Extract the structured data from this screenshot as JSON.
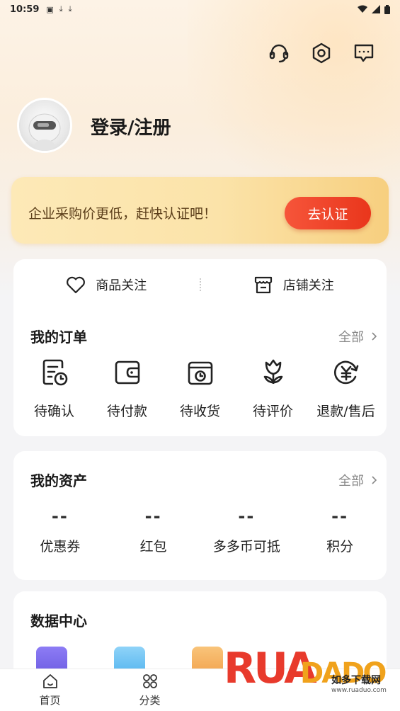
{
  "status_bar": {
    "time": "10:59",
    "icons": [
      "notification-a-icon",
      "download-icon",
      "download-icon"
    ],
    "right_icons": [
      "wifi-icon",
      "signal-icon",
      "battery-icon"
    ]
  },
  "header": {
    "icons": [
      "customer-service-icon",
      "settings-icon",
      "message-icon"
    ],
    "login_text": "登录/注册"
  },
  "banner": {
    "text": "企业采购价更低，赶快认证吧！",
    "button": "去认证",
    "accent": "#ee4328"
  },
  "follow": {
    "items": [
      {
        "label": "商品关注",
        "icon": "heart-icon"
      },
      {
        "label": "店铺关注",
        "icon": "store-icon"
      }
    ]
  },
  "orders": {
    "title": "我的订单",
    "more": "全部",
    "items": [
      {
        "label": "待确认",
        "icon": "pending-confirm-icon"
      },
      {
        "label": "待付款",
        "icon": "wallet-icon"
      },
      {
        "label": "待收货",
        "icon": "package-clock-icon"
      },
      {
        "label": "待评价",
        "icon": "tulip-icon"
      },
      {
        "label": "退款/售后",
        "icon": "refund-icon"
      }
    ]
  },
  "assets": {
    "title": "我的资产",
    "more": "全部",
    "items": [
      {
        "value": "--",
        "label": "优惠券"
      },
      {
        "value": "--",
        "label": "红包"
      },
      {
        "value": "--",
        "label": "多多币可抵"
      },
      {
        "value": "--",
        "label": "积分"
      }
    ]
  },
  "data_center": {
    "title": "数据中心",
    "icons": [
      "purple-doc-icon",
      "blue-clipboard-icon",
      "orange-box-icon"
    ]
  },
  "tabbar": {
    "items": [
      {
        "label": "首页",
        "icon": "home-icon"
      },
      {
        "label": "分类",
        "icon": "category-icon"
      }
    ]
  },
  "watermark": {
    "logo": "RUADADO",
    "sub": "如多下载网",
    "url": "www.ruaduo.com"
  }
}
